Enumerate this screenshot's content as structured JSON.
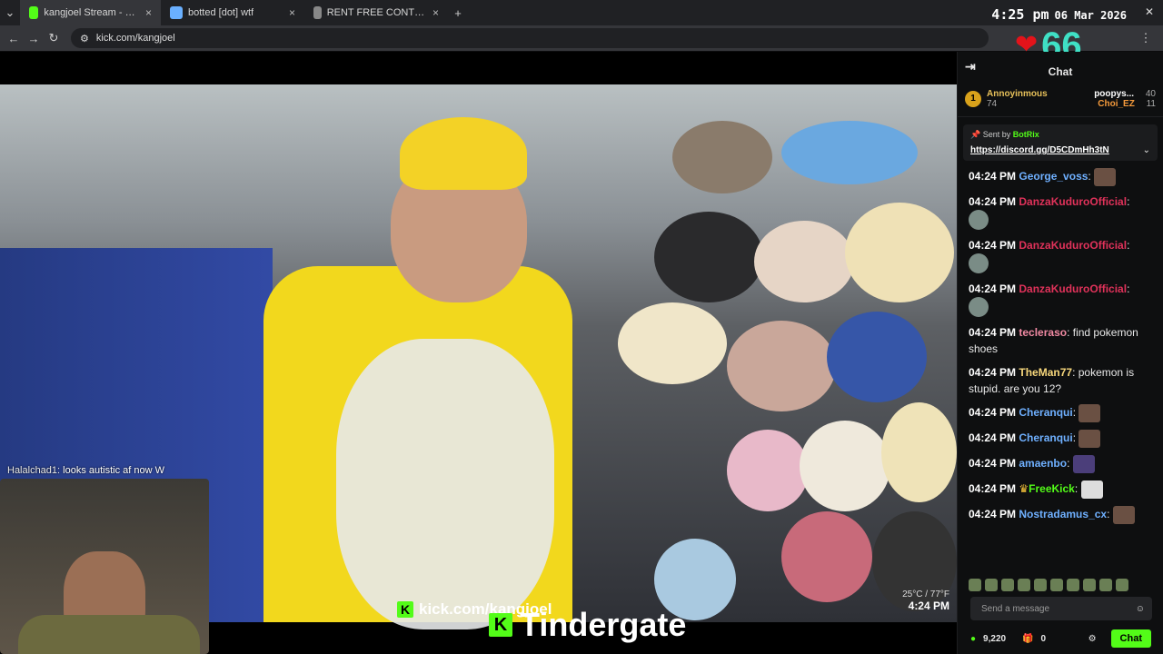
{
  "tabs": [
    {
      "title": "kangjoel Stream - Watch Live",
      "active": true
    },
    {
      "title": "botted [dot] wtf",
      "active": false
    },
    {
      "title": "RENT FREE CONTENT NETWORK",
      "active": false
    }
  ],
  "address": {
    "url": "kick.com/kangjoel"
  },
  "clock": {
    "time": "4:25 pm",
    "date": "06 Mar 2026"
  },
  "overlay": {
    "hearts": "66"
  },
  "video": {
    "overlay_chat_name": "Halalchad1:",
    "overlay_chat_text": "looks autistic af now W",
    "weather": "25°C / 77°F",
    "time": "4:24 PM",
    "watermark": "kick.com/kangjoel",
    "caption": "Tindergate"
  },
  "chat": {
    "title": "Chat",
    "leaders": [
      {
        "rank": "1",
        "name": "Annoyinmous",
        "score": "74"
      },
      {
        "name": "poopys...",
        "score": "40"
      },
      {
        "name": "Choi_EZ",
        "score": "11"
      }
    ],
    "pinned": {
      "sent_by": "Sent by",
      "sender": "BotRix",
      "link": "https://discord.gg/D5CDmHh3tN"
    },
    "messages": [
      {
        "ts": "04:24 PM",
        "user": "George_voss",
        "color": "#6fb0ff",
        "text": ""
      },
      {
        "ts": "04:24 PM",
        "user": "DanzaKuduroOfficial",
        "color": "#e0325a",
        "text": ""
      },
      {
        "ts": "04:24 PM",
        "user": "DanzaKuduroOfficial",
        "color": "#e0325a",
        "text": ""
      },
      {
        "ts": "04:24 PM",
        "user": "DanzaKuduroOfficial",
        "color": "#e0325a",
        "text": ""
      },
      {
        "ts": "04:24 PM",
        "user": "tecleraso",
        "color": "#f18aa3",
        "text": "find pokemon shoes"
      },
      {
        "ts": "04:24 PM",
        "user": "TheMan77",
        "color": "#f7d77b",
        "text": "pokemon is stupid. are you 12?"
      },
      {
        "ts": "04:24 PM",
        "user": "Cheranqui",
        "color": "#6fb0ff",
        "text": ""
      },
      {
        "ts": "04:24 PM",
        "user": "Cheranqui",
        "color": "#6fb0ff",
        "text": ""
      },
      {
        "ts": "04:24 PM",
        "user": "amaenbo",
        "color": "#6fb0ff",
        "text": ""
      },
      {
        "ts": "04:24 PM",
        "user": "FreeKick",
        "color": "#53fc18",
        "text": ""
      },
      {
        "ts": "04:24 PM",
        "user": "Nostradamus_cx",
        "color": "#6fb0ff",
        "text": ""
      }
    ],
    "input_placeholder": "Send a message",
    "points": "9,220",
    "gift_count": "0",
    "send_label": "Chat"
  }
}
